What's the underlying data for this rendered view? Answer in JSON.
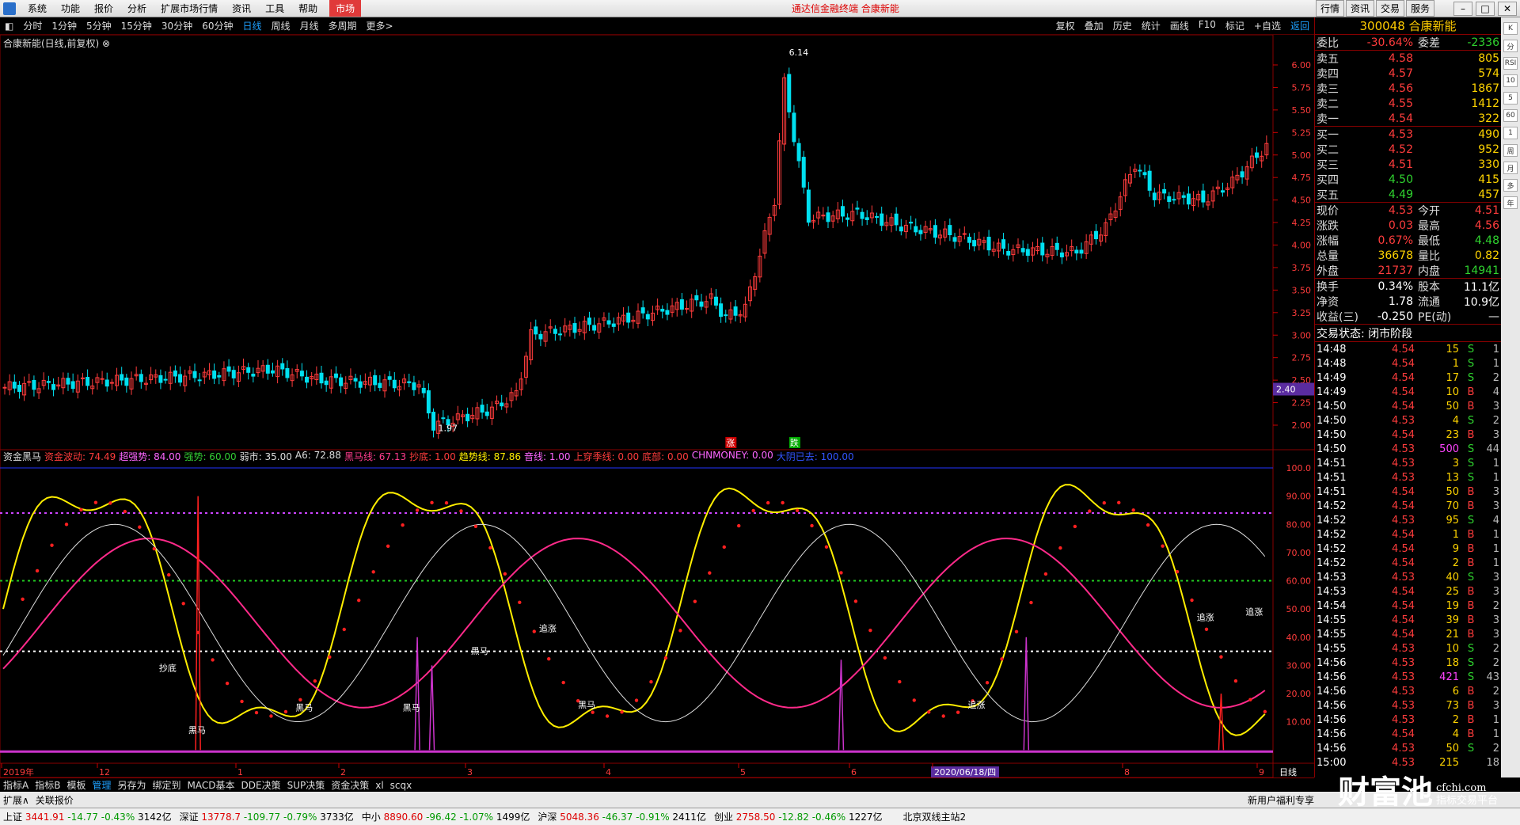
{
  "menu": {
    "items": [
      "系统",
      "功能",
      "报价",
      "分析",
      "扩展市场行情",
      "资讯",
      "工具",
      "帮助"
    ],
    "market": "市场",
    "center_title": "通达信金融终端  合康新能",
    "right_buttons": [
      "行情",
      "资讯",
      "交易",
      "服务"
    ]
  },
  "periods": {
    "items": [
      "分时",
      "1分钟",
      "5分钟",
      "15分钟",
      "30分钟",
      "60分钟",
      "日线",
      "周线",
      "月线",
      "多周期",
      "更多>"
    ],
    "active_index": 6
  },
  "tools": [
    "复权",
    "叠加",
    "历史",
    "统计",
    "画线",
    "F10",
    "标记",
    "+自选",
    "返回"
  ],
  "chart": {
    "title": "合康新能(日线,前复权)",
    "price_axis": [
      "6.00",
      "5.75",
      "5.50",
      "5.25",
      "5.00",
      "4.75",
      "4.50",
      "4.25",
      "4.00",
      "3.75",
      "3.50",
      "3.25",
      "3.00",
      "2.75",
      "2.50",
      "2.25",
      "2.00"
    ],
    "current_price_tag": "2.40",
    "high_label": "6.14",
    "low_label": "1.97",
    "buy_sell_marks": [
      "跌",
      "涨"
    ],
    "indicator_axis": [
      "100.0",
      "90.00",
      "80.00",
      "70.00",
      "60.00",
      "50.00",
      "40.00",
      "30.00",
      "20.00",
      "10.00"
    ],
    "date_axis": [
      "2019年",
      "12",
      "1",
      "2",
      "3",
      "4",
      "5",
      "6",
      "2020/06/18/四",
      "8",
      "9"
    ],
    "period_label": "日线",
    "signal_labels": [
      "抄底",
      "黑马",
      "黑马",
      "黑马",
      "黑马",
      "追涨",
      "黑马",
      "追涨",
      "追涨",
      "追涨"
    ]
  },
  "indicator_legend": [
    {
      "text": "资金黑马",
      "color": "#dddddd"
    },
    {
      "text": "资金波动: 74.49",
      "color": "#ff3c3c"
    },
    {
      "text": "超强势: 84.00",
      "color": "#ff66ff"
    },
    {
      "text": "强势: 60.00",
      "color": "#33cc33"
    },
    {
      "text": "弱市: 35.00",
      "color": "#dddddd"
    },
    {
      "text": "A6: 72.88",
      "color": "#dddddd"
    },
    {
      "text": "黑马线: 67.13",
      "color": "#ff3c8c"
    },
    {
      "text": "抄底: 1.00",
      "color": "#ff3c3c"
    },
    {
      "text": "趋势线: 87.86",
      "color": "#ffee00"
    },
    {
      "text": "音线: 1.00",
      "color": "#ff66ff"
    },
    {
      "text": "上穿季线: 0.00",
      "color": "#ff3c3c"
    },
    {
      "text": "底部: 0.00",
      "color": "#ff3c3c"
    },
    {
      "text": "CHNMONEY: 0.00",
      "color": "#ff66ff"
    },
    {
      "text": "大阴已去: 100.00",
      "color": "#3355ff"
    }
  ],
  "quote": {
    "code_name": "300048 合康新能",
    "weibi_label": "委比",
    "weibi": "-30.64%",
    "weicha_label": "委差",
    "weicha": "-2336",
    "asks": [
      {
        "label": "卖五",
        "price": "4.58",
        "vol": "805"
      },
      {
        "label": "卖四",
        "price": "4.57",
        "vol": "574"
      },
      {
        "label": "卖三",
        "price": "4.56",
        "vol": "1867"
      },
      {
        "label": "卖二",
        "price": "4.55",
        "vol": "1412"
      },
      {
        "label": "卖一",
        "price": "4.54",
        "vol": "322"
      }
    ],
    "bids": [
      {
        "label": "买一",
        "price": "4.53",
        "vol": "490"
      },
      {
        "label": "买二",
        "price": "4.52",
        "vol": "952"
      },
      {
        "label": "买三",
        "price": "4.51",
        "vol": "330"
      },
      {
        "label": "买四",
        "price": "4.50",
        "vol": "415"
      },
      {
        "label": "买五",
        "price": "4.49",
        "vol": "457"
      }
    ],
    "stats": [
      {
        "l": "现价",
        "v": "4.53",
        "vc": "red",
        "l2": "今开",
        "v2": "4.51",
        "v2c": "red"
      },
      {
        "l": "涨跌",
        "v": "0.03",
        "vc": "red",
        "l2": "最高",
        "v2": "4.56",
        "v2c": "red"
      },
      {
        "l": "涨幅",
        "v": "0.67%",
        "vc": "red",
        "l2": "最低",
        "v2": "4.48",
        "v2c": "green"
      },
      {
        "l": "总量",
        "v": "36678",
        "vc": "yellow",
        "l2": "量比",
        "v2": "0.82",
        "v2c": "yellow"
      },
      {
        "l": "外盘",
        "v": "21737",
        "vc": "red",
        "l2": "内盘",
        "v2": "14941",
        "v2c": "green"
      }
    ],
    "stats2": [
      {
        "l": "换手",
        "v": "0.34%",
        "l2": "股本",
        "v2": "11.1亿"
      },
      {
        "l": "净资",
        "v": "1.78",
        "l2": "流通",
        "v2": "10.9亿"
      },
      {
        "l": "收益(三)",
        "v": "-0.250",
        "l2": "PE(动)",
        "v2": "—"
      }
    ],
    "status": "交易状态: 闭市阶段",
    "ticks": [
      {
        "t": "14:48",
        "p": "4.54",
        "v": "15",
        "bs": "S",
        "n": "1"
      },
      {
        "t": "14:48",
        "p": "4.54",
        "v": "1",
        "bs": "S",
        "n": "1"
      },
      {
        "t": "14:49",
        "p": "4.54",
        "v": "17",
        "bs": "S",
        "n": "2"
      },
      {
        "t": "14:49",
        "p": "4.54",
        "v": "10",
        "bs": "B",
        "n": "4"
      },
      {
        "t": "14:50",
        "p": "4.54",
        "v": "50",
        "bs": "B",
        "n": "3"
      },
      {
        "t": "14:50",
        "p": "4.53",
        "v": "4",
        "bs": "S",
        "n": "2"
      },
      {
        "t": "14:50",
        "p": "4.54",
        "v": "23",
        "bs": "B",
        "n": "3"
      },
      {
        "t": "14:50",
        "p": "4.53",
        "v": "500",
        "bs": "S",
        "n": "44"
      },
      {
        "t": "14:51",
        "p": "4.53",
        "v": "3",
        "bs": "S",
        "n": "1"
      },
      {
        "t": "14:51",
        "p": "4.53",
        "v": "13",
        "bs": "S",
        "n": "1"
      },
      {
        "t": "14:51",
        "p": "4.54",
        "v": "50",
        "bs": "B",
        "n": "3"
      },
      {
        "t": "14:52",
        "p": "4.54",
        "v": "70",
        "bs": "B",
        "n": "3"
      },
      {
        "t": "14:52",
        "p": "4.53",
        "v": "95",
        "bs": "S",
        "n": "4"
      },
      {
        "t": "14:52",
        "p": "4.54",
        "v": "1",
        "bs": "B",
        "n": "1"
      },
      {
        "t": "14:52",
        "p": "4.54",
        "v": "9",
        "bs": "B",
        "n": "1"
      },
      {
        "t": "14:52",
        "p": "4.54",
        "v": "2",
        "bs": "B",
        "n": "1"
      },
      {
        "t": "14:53",
        "p": "4.53",
        "v": "40",
        "bs": "S",
        "n": "3"
      },
      {
        "t": "14:53",
        "p": "4.54",
        "v": "25",
        "bs": "B",
        "n": "3"
      },
      {
        "t": "14:54",
        "p": "4.54",
        "v": "19",
        "bs": "B",
        "n": "2"
      },
      {
        "t": "14:55",
        "p": "4.54",
        "v": "39",
        "bs": "B",
        "n": "3"
      },
      {
        "t": "14:55",
        "p": "4.54",
        "v": "21",
        "bs": "B",
        "n": "3"
      },
      {
        "t": "14:55",
        "p": "4.53",
        "v": "10",
        "bs": "S",
        "n": "2"
      },
      {
        "t": "14:56",
        "p": "4.53",
        "v": "18",
        "bs": "S",
        "n": "2"
      },
      {
        "t": "14:56",
        "p": "4.53",
        "v": "421",
        "bs": "S",
        "n": "43"
      },
      {
        "t": "14:56",
        "p": "4.53",
        "v": "6",
        "bs": "B",
        "n": "2"
      },
      {
        "t": "14:56",
        "p": "4.53",
        "v": "73",
        "bs": "B",
        "n": "3"
      },
      {
        "t": "14:56",
        "p": "4.53",
        "v": "2",
        "bs": "B",
        "n": "1"
      },
      {
        "t": "14:56",
        "p": "4.54",
        "v": "4",
        "bs": "B",
        "n": "1"
      },
      {
        "t": "14:56",
        "p": "4.53",
        "v": "50",
        "bs": "S",
        "n": "2"
      },
      {
        "t": "15:00",
        "p": "4.53",
        "v": "215",
        "bs": "",
        "n": "18"
      }
    ]
  },
  "side_toolbar": [
    "K",
    "分",
    "RSI",
    "10",
    "5",
    "60",
    "1",
    "周",
    "月",
    "多",
    "年"
  ],
  "bottom_tabs": [
    "指标A",
    "指标B",
    "模板",
    "管理",
    "另存为",
    "绑定到",
    "MACD基本",
    "DDE决策",
    "SUP决策",
    "资金决策",
    "xl",
    "scqx"
  ],
  "bottom_active": 3,
  "ext_bar": [
    "扩展∧",
    "关联报价"
  ],
  "promo": "新用户福利专享",
  "indices": [
    {
      "name": "上证",
      "v": "3441.91",
      "d": "-14.77",
      "p": "-0.43%",
      "amt": "3142亿"
    },
    {
      "name": "深证",
      "v": "13778.7",
      "d": "-109.77",
      "p": "-0.79%",
      "amt": "3733亿"
    },
    {
      "name": "中小",
      "v": "8890.60",
      "d": "-96.42",
      "p": "-1.07%",
      "amt": "1499亿"
    },
    {
      "name": "沪深",
      "v": "5048.36",
      "d": "-46.37",
      "p": "-0.91%",
      "amt": "2411亿"
    },
    {
      "name": "创业",
      "v": "2758.50",
      "d": "-12.82",
      "p": "-0.46%",
      "amt": "1227亿"
    }
  ],
  "server": "北京双线主站2",
  "watermark": {
    "main": "财富池",
    "sub1": "cfchi.com",
    "sub2": "指标交易平台"
  },
  "colors": {
    "up": "#ff3c3c",
    "down": "#00e0f0",
    "bg": "#000000",
    "accent": "#1ea1ff"
  }
}
